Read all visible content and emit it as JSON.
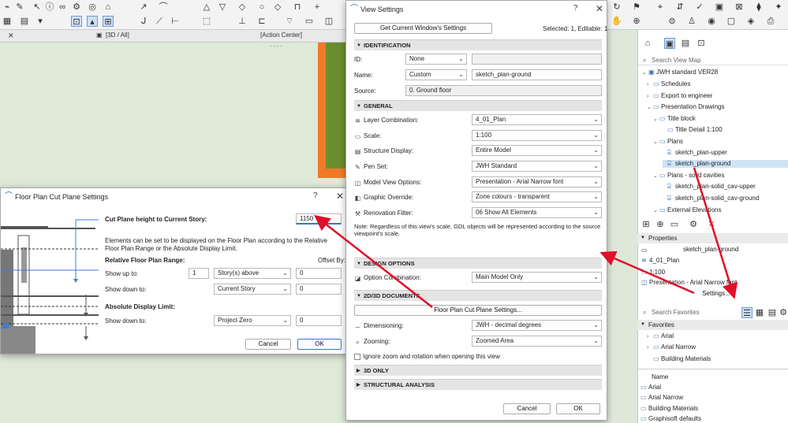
{
  "tabs": {
    "tab_3d": "[3D / All]",
    "tab_action": "[Action Center]",
    "dashes": "- - - -"
  },
  "view_settings": {
    "title": "View Settings",
    "help": "?",
    "close": "✕",
    "get_current_button": "Get Current Window's Settings",
    "selected_info": "Selected: 1, Editable: 1",
    "sections": {
      "identification": "IDENTIFICATION",
      "general": "GENERAL",
      "design_options": "DESIGN OPTIONS",
      "docs_2d3d": "2D/3D DOCUMENTS",
      "only_3d": "3D ONLY",
      "structural": "STRUCTURAL ANALYSIS"
    },
    "id_label": "ID:",
    "id_value": "None",
    "id_text": "",
    "name_label": "Name:",
    "name_mode": "Custom",
    "name_value": "sketch_plan-ground",
    "source_label": "Source:",
    "source_value": "0. Ground floor",
    "layer_label": "Layer Combination:",
    "layer_value": "4_01_Plan",
    "scale_label": "Scale:",
    "scale_value": "1:100",
    "structure_label": "Structure Display:",
    "structure_value": "Entire Model",
    "penset_label": "Pen Set:",
    "penset_value": "JWH Standard",
    "mvo_label": "Model View Options:",
    "mvo_value": "Presentation - Arial Narrow font",
    "graphic_label": "Graphic Override:",
    "graphic_value": "Zone colours - transparent",
    "renovation_label": "Renovation Filter:",
    "renovation_value": "06 Show All Elements",
    "note": "Note: Regardless of this view's scale, GDL objects will be represented according to the source viewpoint's scale.",
    "option_label": "Option Combination:",
    "option_value": "Main Model Only",
    "cut_plane_button": "Floor Plan Cut Plane Settings...",
    "dimensioning_label": "Dimensioning:",
    "dimensioning_value": "JWH - decimal degrees",
    "zooming_label": "Zooming:",
    "zooming_value": "Zoomed Area",
    "ignore_zoom": "Ignore zoom and rotation when opening this view",
    "cancel": "Cancel",
    "ok": "OK"
  },
  "cut_plane": {
    "title": "Floor Plan Cut Plane Settings",
    "help": "?",
    "close": "✕",
    "height_label": "Cut Plane height to Current Story:",
    "height_value": "1150",
    "description": "Elements can be set to be displayed on the Floor Plan according to the Relative Floor Plan Range or the Absolute Display Limit.",
    "relative_label": "Relative Floor Plan Range:",
    "offset_by": "Offset By:",
    "show_up_label": "Show up to:",
    "show_up_count": "1",
    "show_up_mode": "Story(s) above",
    "show_up_offset": "0",
    "show_down_label": "Show down to:",
    "show_down_mode": "Current Story",
    "show_down_offset": "0",
    "absolute_label": "Absolute Display Limit:",
    "abs_down_label": "Show down to:",
    "abs_down_mode": "Project Zero",
    "abs_down_offset": "0",
    "cancel": "Cancel",
    "ok": "OK"
  },
  "view_map": {
    "search_placeholder": "Search View Map",
    "items": [
      "JWH standard VER28",
      "Schedules",
      "Export to engineer",
      "Presentation Drawings",
      "Title block",
      "Title Detail 1:100",
      "Plans",
      "sketch_plan-upper",
      "sketch_plan-ground",
      "Plans - solid cavities",
      "sketch_plan-solid_cav-upper",
      "sketch_plan-solid_cav-ground",
      "External Elevations"
    ]
  },
  "properties": {
    "header": "Properties",
    "name_value": "sketch_plan-ground",
    "layer_value": "4_01_Plan",
    "scale_value": "1:100",
    "mvo_value": "Presentation - Arial Narrow font",
    "settings_button": "Settings..."
  },
  "favorites": {
    "search_placeholder": "Search Favorites",
    "header": "Favorites",
    "items": [
      "Arial",
      "Arial Narrow",
      "Building Materials"
    ]
  },
  "name_list": {
    "header": "Name",
    "items": [
      "Arial",
      "Arial Narrow",
      "Building Materials",
      "Graphisoft defaults"
    ]
  },
  "colors": {
    "accent": "#3178d0",
    "arrow": "#e0102a",
    "orange": "#f07a2a",
    "olive": "#6a8e2f"
  }
}
